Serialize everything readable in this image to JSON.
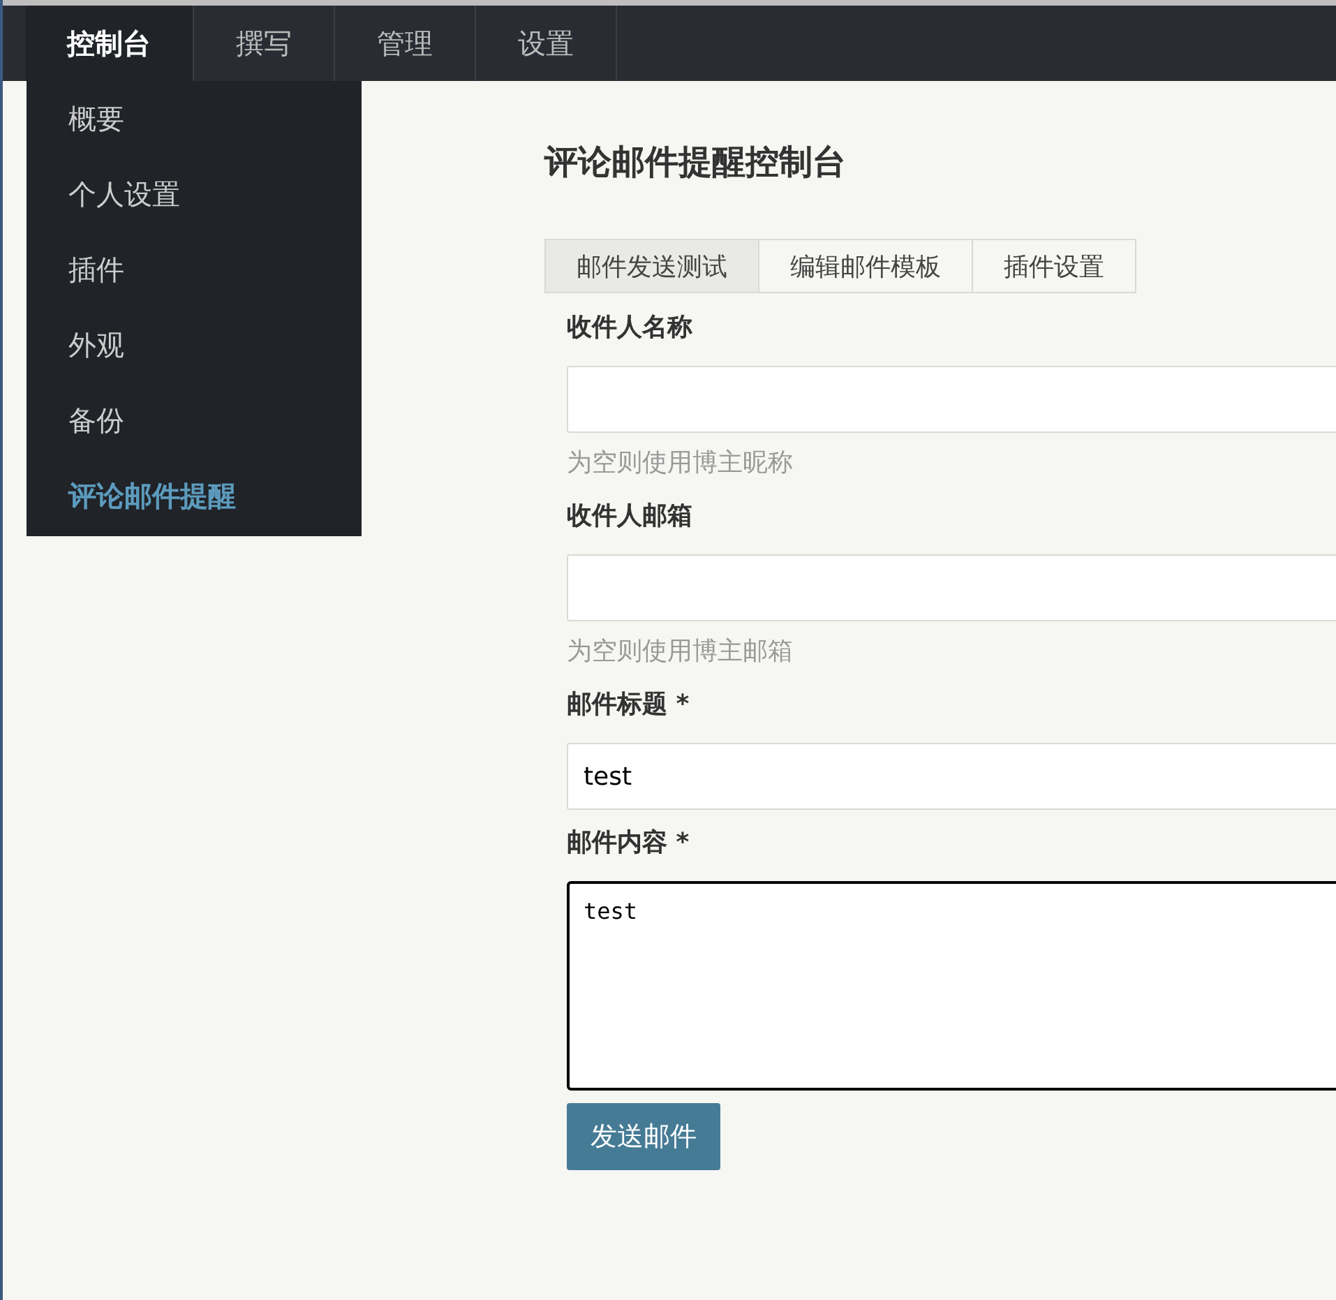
{
  "nav": {
    "tabs": [
      {
        "label": "控制台",
        "selected": true
      },
      {
        "label": "撰写",
        "selected": false
      },
      {
        "label": "管理",
        "selected": false
      },
      {
        "label": "设置",
        "selected": false
      }
    ]
  },
  "menu": {
    "items": [
      {
        "label": "概要",
        "selected": false
      },
      {
        "label": "个人设置",
        "selected": false
      },
      {
        "label": "插件",
        "selected": false
      },
      {
        "label": "外观",
        "selected": false
      },
      {
        "label": "备份",
        "selected": false
      },
      {
        "label": "评论邮件提醒",
        "selected": true
      }
    ]
  },
  "page": {
    "title": "评论邮件提醒控制台"
  },
  "tabs": [
    {
      "label": "邮件发送测试",
      "selected": true
    },
    {
      "label": "编辑邮件模板",
      "selected": false
    },
    {
      "label": "插件设置",
      "selected": false
    }
  ],
  "form": {
    "fields": [
      {
        "kind": "input",
        "label": "收件人名称",
        "hint": "为空则使用博主昵称",
        "focused": false
      },
      {
        "kind": "input",
        "label": "收件人邮箱",
        "hint": "为空则使用博主邮箱",
        "focused": false
      },
      {
        "kind": "input",
        "label": "邮件标题 *",
        "value": "test",
        "focused": false
      },
      {
        "kind": "textarea",
        "label": "邮件内容 *",
        "value": "test",
        "focused": true
      }
    ],
    "submit": "发送邮件"
  }
}
